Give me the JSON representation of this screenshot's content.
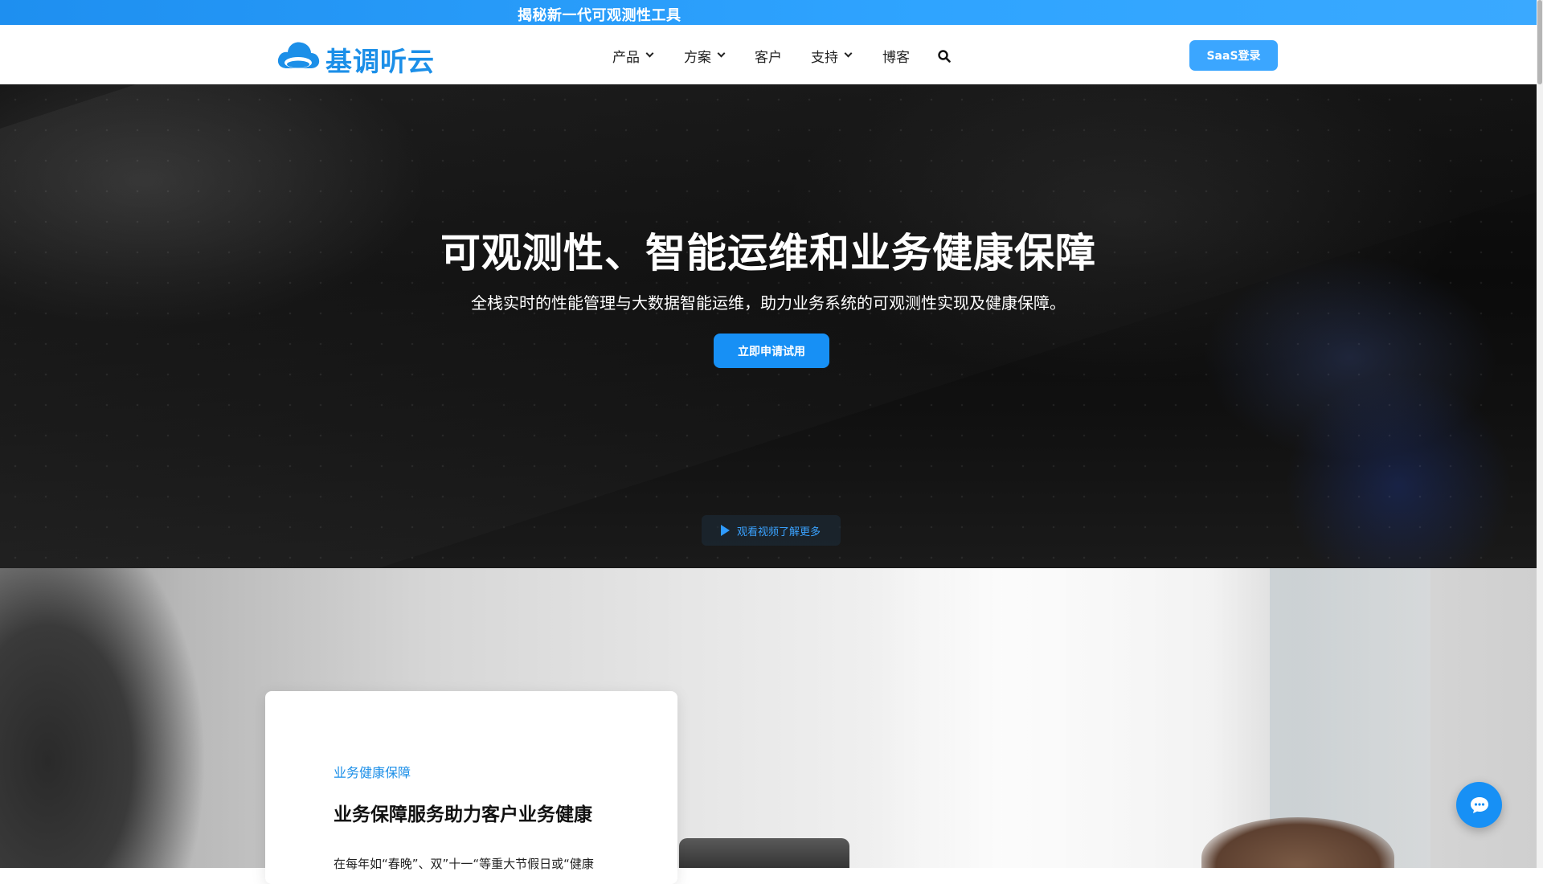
{
  "announcement": {
    "text": "揭秘新一代可观测性工具"
  },
  "header": {
    "logo_text": "基调听云",
    "nav": [
      {
        "label": "产品",
        "has_dropdown": true
      },
      {
        "label": "方案",
        "has_dropdown": true
      },
      {
        "label": "客户",
        "has_dropdown": false
      },
      {
        "label": "支持",
        "has_dropdown": true
      },
      {
        "label": "博客",
        "has_dropdown": false
      }
    ],
    "search_icon": "search-icon",
    "saas_login_label": "SaaS登录"
  },
  "hero": {
    "title": "可观测性、智能运维和业务健康保障",
    "subtitle": "全栈实时的性能管理与大数据智能运维，助力业务系统的可观测性实现及健康保障。",
    "cta_label": "立即申请试用",
    "video_label": "观看视频了解更多"
  },
  "feature_card": {
    "eyebrow": "业务健康保障",
    "title": "业务保障服务助力客户业务健康",
    "body": "在每年如“春晚”、双”十一“等重大节假日或“健康"
  },
  "chat": {
    "icon": "chat-bubble-icon"
  },
  "colors": {
    "brand_blue": "#1790f5",
    "announce_bar": "#2fa4ff",
    "login_button": "#3ba6ff"
  }
}
